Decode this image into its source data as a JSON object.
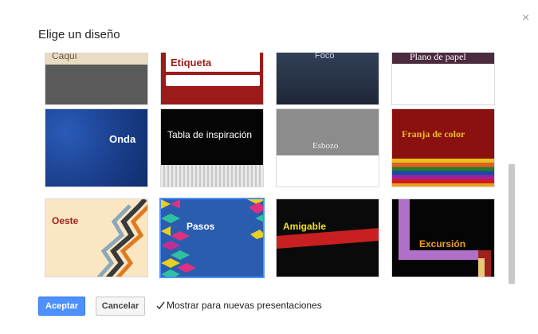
{
  "dialog": {
    "title": "Elige un diseño",
    "close_icon": "×"
  },
  "themes": [
    {
      "name": "Caqui",
      "row": 0,
      "col": 0
    },
    {
      "name": "Etiqueta",
      "row": 0,
      "col": 1
    },
    {
      "name": "Foco",
      "row": 0,
      "col": 2
    },
    {
      "name": "Plano de papel",
      "row": 0,
      "col": 3
    },
    {
      "name": "Onda",
      "row": 1,
      "col": 0
    },
    {
      "name": "Tabla de inspiración",
      "row": 1,
      "col": 1
    },
    {
      "name": "Esbozo",
      "row": 1,
      "col": 2
    },
    {
      "name": "Franja de color",
      "row": 1,
      "col": 3
    },
    {
      "name": "Oeste",
      "row": 2,
      "col": 0
    },
    {
      "name": "Pasos",
      "row": 2,
      "col": 1,
      "selected": true
    },
    {
      "name": "Amigable",
      "row": 2,
      "col": 2
    },
    {
      "name": "Excursión",
      "row": 2,
      "col": 3
    }
  ],
  "footer": {
    "accept_label": "Aceptar",
    "cancel_label": "Cancelar",
    "checkbox_label": "Mostrar para nuevas presentaciones",
    "checkbox_checked": true
  },
  "colors": {
    "primary": "#4d90fe",
    "selected_border": "#4d90fe"
  }
}
